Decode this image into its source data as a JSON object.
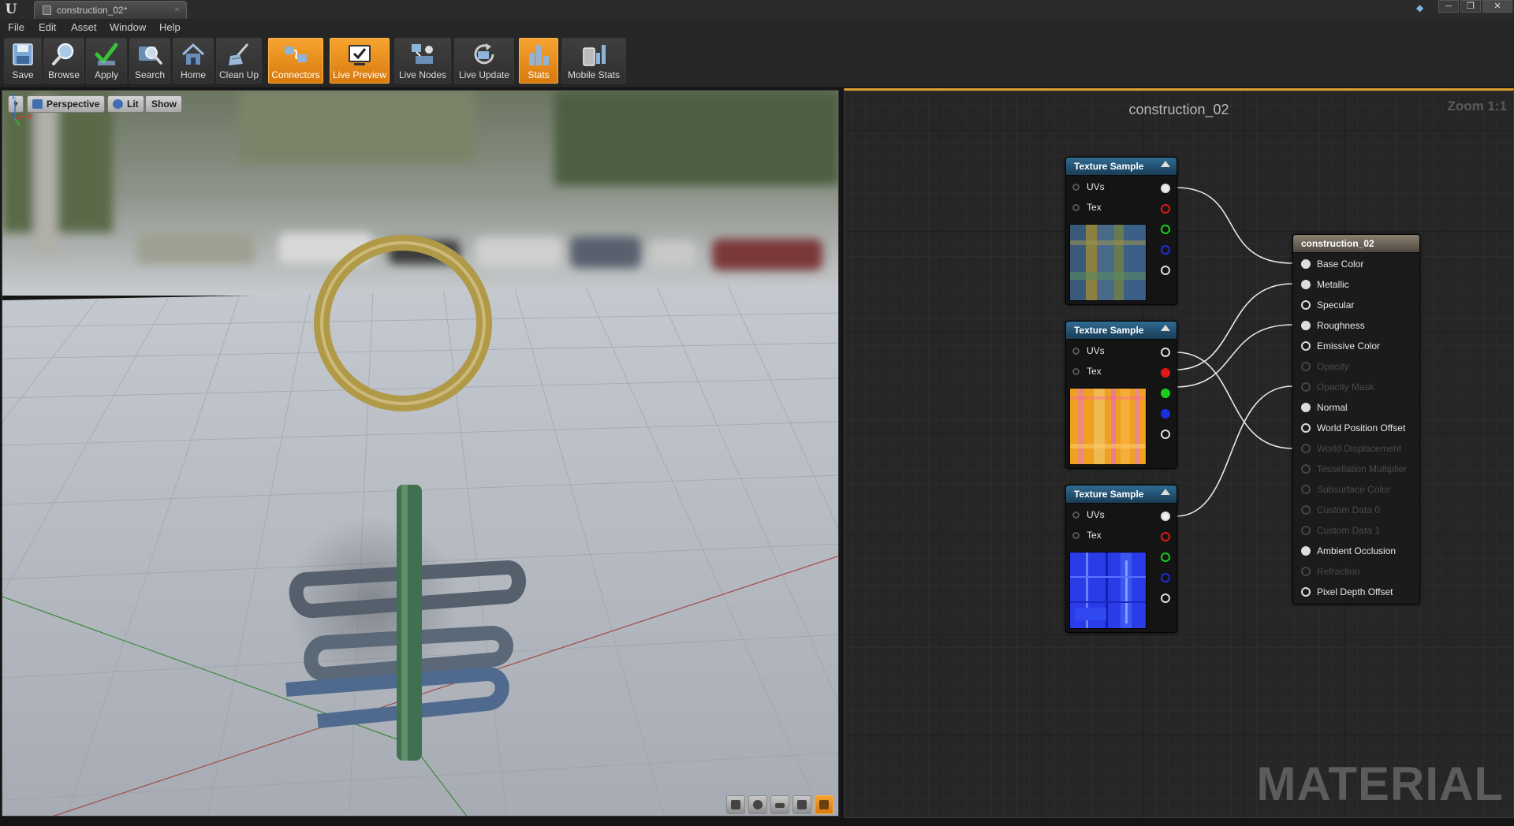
{
  "window": {
    "tab_title": "construction_02*",
    "tab_close": "×",
    "minimize": "─",
    "maximize": "❐",
    "close": "✕"
  },
  "menu": [
    "File",
    "Edit",
    "Asset",
    "Window",
    "Help"
  ],
  "toolbar": [
    {
      "label": "Save",
      "icon": "save-icon",
      "active": false
    },
    {
      "label": "Browse",
      "icon": "browse-icon",
      "active": false
    },
    {
      "label": "Apply",
      "icon": "apply-icon",
      "active": false
    },
    {
      "label": "Search",
      "icon": "search-icon",
      "active": false
    },
    {
      "label": "Home",
      "icon": "home-icon",
      "active": false
    },
    {
      "label": "Clean Up",
      "icon": "clean-up-icon",
      "active": false
    },
    {
      "label": "Connectors",
      "icon": "connectors-icon",
      "active": true
    },
    {
      "label": "Live Preview",
      "icon": "live-preview-icon",
      "active": true
    },
    {
      "label": "Live Nodes",
      "icon": "live-nodes-icon",
      "active": false
    },
    {
      "label": "Live Update",
      "icon": "live-update-icon",
      "active": false
    },
    {
      "label": "Stats",
      "icon": "stats-icon",
      "active": true
    },
    {
      "label": "Mobile Stats",
      "icon": "mobile-stats-icon",
      "active": false
    }
  ],
  "viewport": {
    "view_mode": "Perspective",
    "lighting": "Lit",
    "show": "Show",
    "axis_z": "z",
    "axis_x": "x"
  },
  "graph": {
    "title": "construction_02",
    "zoom": "Zoom 1:1",
    "watermark": "MATERIAL",
    "texture_nodes": [
      {
        "title": "Texture Sample",
        "in_uvs": "UVs",
        "in_tex": "Tex",
        "thumbnail": "base-color-texture"
      },
      {
        "title": "Texture Sample",
        "in_uvs": "UVs",
        "in_tex": "Tex",
        "thumbnail": "orm-texture"
      },
      {
        "title": "Texture Sample",
        "in_uvs": "UVs",
        "in_tex": "Tex",
        "thumbnail": "normal-map-texture"
      }
    ],
    "result_node": {
      "title": "construction_02",
      "pins": [
        {
          "label": "Base Color",
          "state": "connected"
        },
        {
          "label": "Metallic",
          "state": "connected"
        },
        {
          "label": "Specular",
          "state": "enabled"
        },
        {
          "label": "Roughness",
          "state": "connected"
        },
        {
          "label": "Emissive Color",
          "state": "enabled"
        },
        {
          "label": "Opacity",
          "state": "disabled"
        },
        {
          "label": "Opacity Mask",
          "state": "disabled"
        },
        {
          "label": "Normal",
          "state": "connected"
        },
        {
          "label": "World Position Offset",
          "state": "enabled"
        },
        {
          "label": "World Displacement",
          "state": "disabled"
        },
        {
          "label": "Tessellation Multiplier",
          "state": "disabled"
        },
        {
          "label": "Subsurface Color",
          "state": "disabled"
        },
        {
          "label": "Custom Data 0",
          "state": "disabled"
        },
        {
          "label": "Custom Data 1",
          "state": "disabled"
        },
        {
          "label": "Ambient Occlusion",
          "state": "connected"
        },
        {
          "label": "Refraction",
          "state": "disabled"
        },
        {
          "label": "Pixel Depth Offset",
          "state": "enabled"
        }
      ]
    }
  },
  "colors": {
    "accent_orange": "#f0962a",
    "node_header_blue": "#2f6b92",
    "result_header": "#8a8070",
    "pin_red": "#e01818",
    "pin_green": "#18d018",
    "pin_blue": "#1830e0"
  }
}
